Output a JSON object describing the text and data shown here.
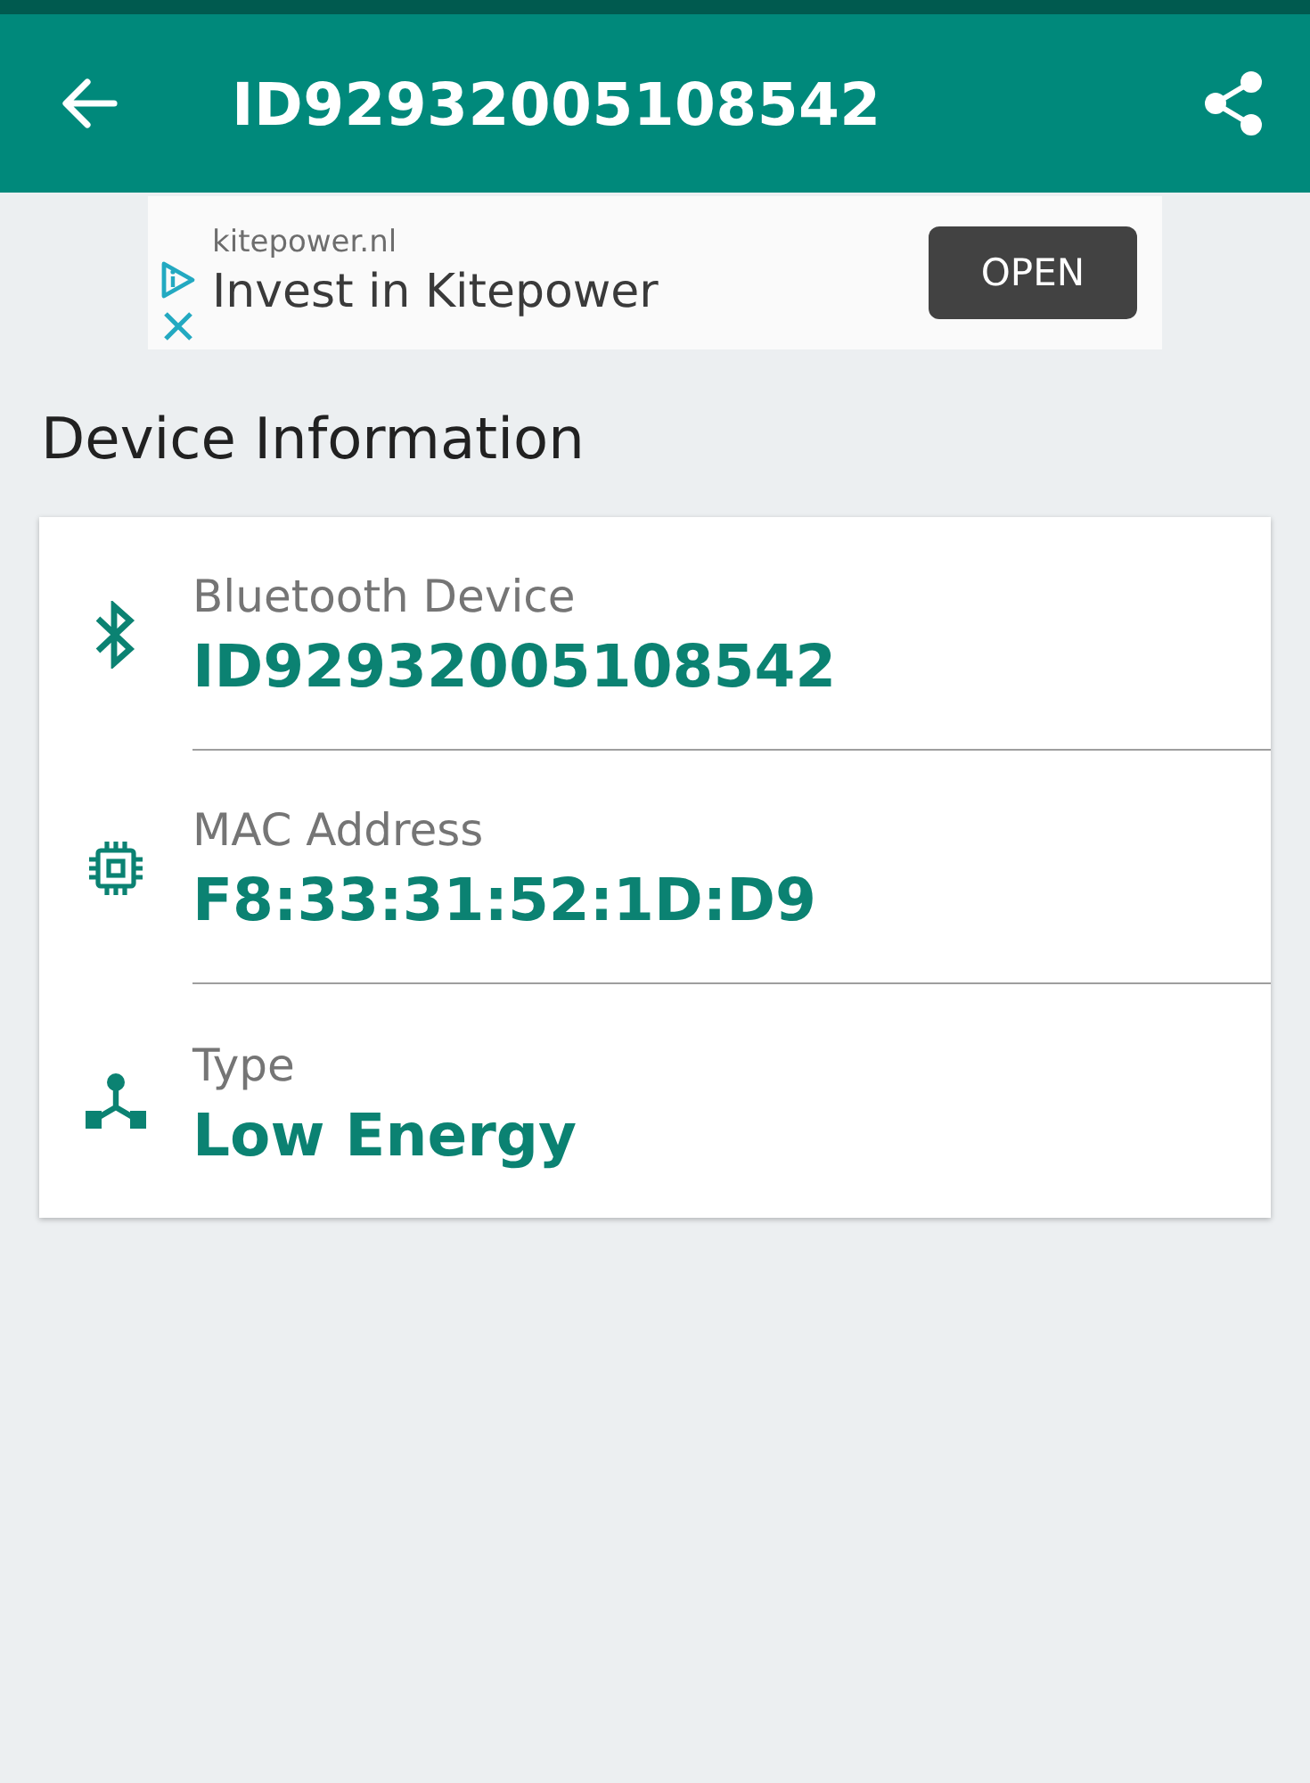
{
  "app_bar": {
    "title": "ID92932005108542"
  },
  "ad": {
    "domain": "kitepower.nl",
    "headline": "Invest in Kitepower",
    "button": "OPEN"
  },
  "section": {
    "title": "Device Information"
  },
  "details": [
    {
      "kind": "bluetooth",
      "label": "Bluetooth Device",
      "value": "ID92932005108542"
    },
    {
      "kind": "chip",
      "label": "MAC Address",
      "value": "F8:33:31:52:1D:D9"
    },
    {
      "kind": "type",
      "label": "Type",
      "value": "Low Energy"
    }
  ]
}
